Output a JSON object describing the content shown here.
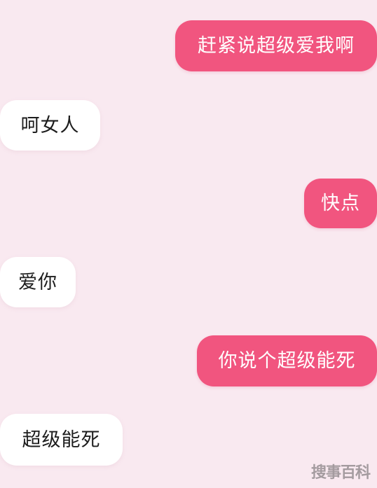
{
  "messages": [
    {
      "id": "msg1",
      "side": "out",
      "text": "赶紧说超级爱我啊"
    },
    {
      "id": "msg2",
      "side": "in",
      "text": "呵女人"
    },
    {
      "id": "msg3",
      "side": "out",
      "text": "快点"
    },
    {
      "id": "msg4",
      "side": "in",
      "text": "爱你"
    },
    {
      "id": "msg5",
      "side": "out",
      "text": "你说个超级能死"
    },
    {
      "id": "msg6",
      "side": "in",
      "text": "超级能死"
    }
  ],
  "watermark": "搜事百科",
  "colors": {
    "background": "#f9e9f0",
    "outgoing_bubble": "#f1557f",
    "incoming_bubble": "#ffffff"
  }
}
